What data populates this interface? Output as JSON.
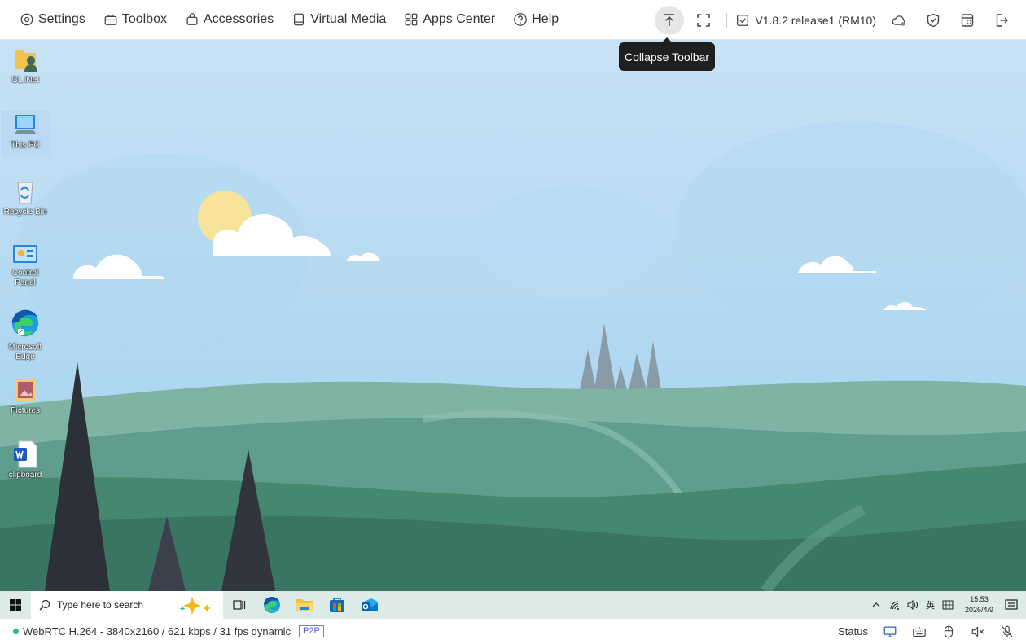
{
  "toolbar": {
    "menu": [
      {
        "label": "Settings",
        "icon": "gear-icon"
      },
      {
        "label": "Toolbox",
        "icon": "toolbox-icon"
      },
      {
        "label": "Accessories",
        "icon": "bag-icon"
      },
      {
        "label": "Virtual Media",
        "icon": "drive-icon"
      },
      {
        "label": "Apps Center",
        "icon": "apps-icon"
      },
      {
        "label": "Help",
        "icon": "help-icon"
      }
    ],
    "version": "V1.8.2 release1 (RM10)",
    "tooltip": "Collapse Toolbar"
  },
  "desktop_icons": [
    {
      "label": "GL.iNet"
    },
    {
      "label": "This PC"
    },
    {
      "label": "Recycle Bin"
    },
    {
      "label": "Control Panel"
    },
    {
      "label": "Microsoft Edge"
    },
    {
      "label": "Pictures"
    },
    {
      "label": "clipboard"
    }
  ],
  "taskbar": {
    "search_placeholder": "Type here to search",
    "ime": "英",
    "time": "15:53",
    "date": "2026/4/9"
  },
  "statusbar": {
    "stream": "WebRTC H.264 - 3840x2160 /  621 kbps / 31 fps dynamic",
    "mode": "P2P",
    "status_label": "Status"
  },
  "colors": {
    "accent_green": "#1fbf8a",
    "p2p_blue": "#4a5cc8"
  }
}
